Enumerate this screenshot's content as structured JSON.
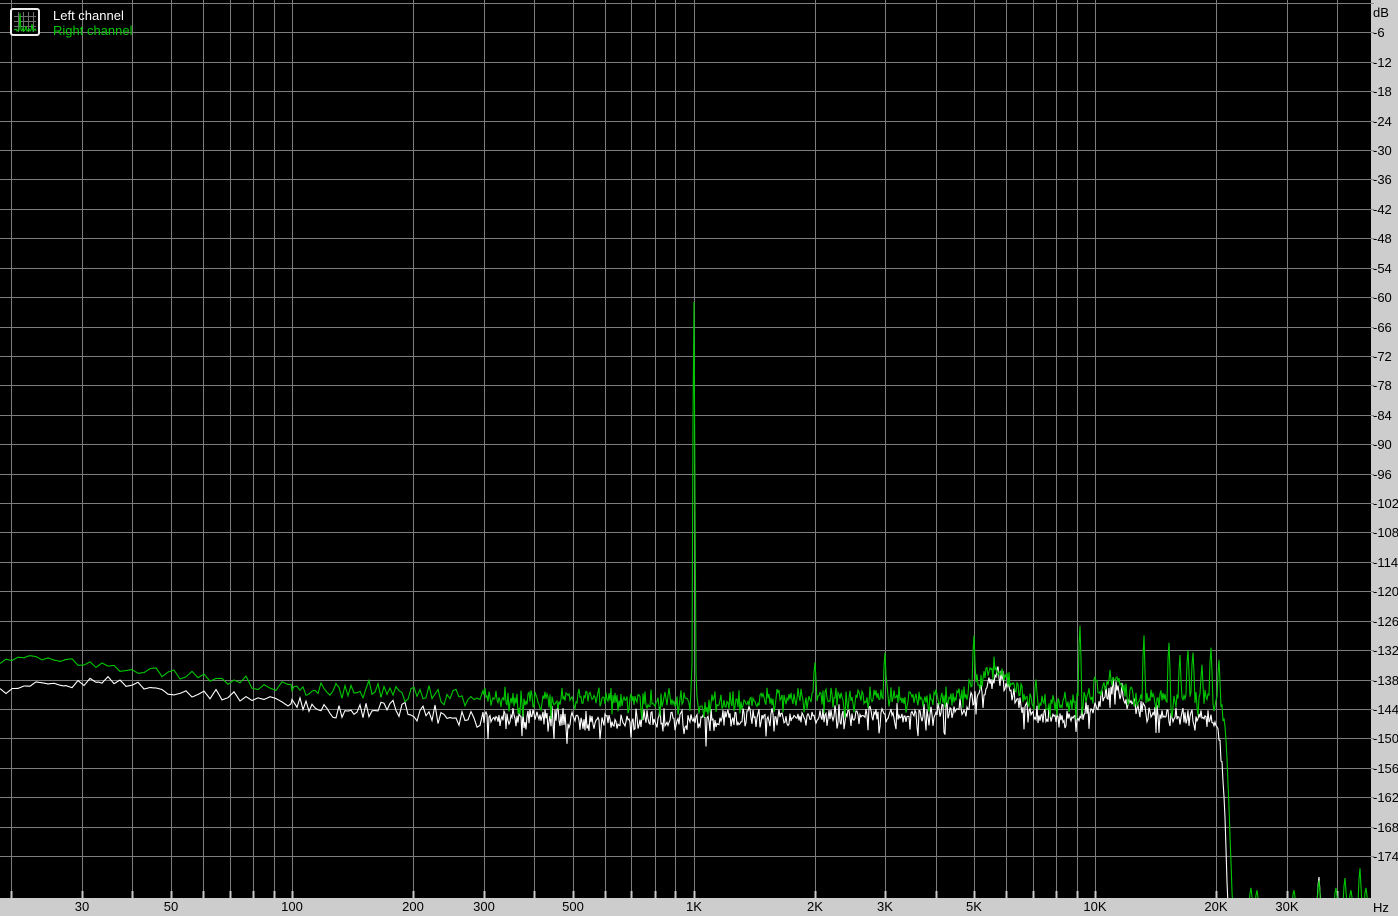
{
  "legend": {
    "icon": "spectrum-thumbnail-icon",
    "items": [
      {
        "label": "Left channel",
        "color": "#ffffff"
      },
      {
        "label": "Right channel",
        "color": "#00c800"
      }
    ]
  },
  "colors": {
    "background": "#000000",
    "grid": "#7d7d7d",
    "axis_bar": "#cdcdcd",
    "axis_text": "#000000",
    "bottom_tick": "#c9c9c9",
    "left_channel": "#ffffff",
    "right_channel": "#00c800"
  },
  "y_axis": {
    "unit_label": "dB",
    "step_db": 6,
    "tick_labels": [
      "dB",
      "-6",
      "-12",
      "-18",
      "-24",
      "-30",
      "-36",
      "-42",
      "-48",
      "-54",
      "-60",
      "-66",
      "-72",
      "-78",
      "-84",
      "-90",
      "-96",
      "-102",
      "-108",
      "-114",
      "-120",
      "-126",
      "-132",
      "-138",
      "-144",
      "-150",
      "-156",
      "-162",
      "-168",
      "-174"
    ]
  },
  "x_axis": {
    "unit_label": "Hz",
    "labeled_ticks": [
      {
        "label": "30",
        "freq": 30
      },
      {
        "label": "50",
        "freq": 50
      },
      {
        "label": "100",
        "freq": 100
      },
      {
        "label": "200",
        "freq": 200
      },
      {
        "label": "300",
        "freq": 300
      },
      {
        "label": "500",
        "freq": 500
      },
      {
        "label": "1K",
        "freq": 1000
      },
      {
        "label": "2K",
        "freq": 2000
      },
      {
        "label": "3K",
        "freq": 3000
      },
      {
        "label": "5K",
        "freq": 5000
      },
      {
        "label": "10K",
        "freq": 10000
      },
      {
        "label": "20K",
        "freq": 20000
      },
      {
        "label": "30K",
        "freq": 30000
      }
    ],
    "gridline_freqs": [
      20,
      30,
      40,
      50,
      60,
      70,
      80,
      90,
      100,
      200,
      300,
      400,
      500,
      600,
      700,
      800,
      900,
      1000,
      2000,
      3000,
      4000,
      5000,
      6000,
      7000,
      8000,
      9000,
      10000,
      20000,
      30000,
      40000
    ]
  },
  "chart_data": {
    "type": "line",
    "x_scale": "log",
    "x_unit": "Hz",
    "y_unit": "dB",
    "x_range": [
      20,
      48000
    ],
    "y_range": [
      -180,
      0
    ],
    "y_gridline_step_db": 6,
    "grid": true,
    "legend_position": "top-left",
    "description": "FFT noise spectrum, two channels; 1 kHz test tone present in right channel only; both channels cut off sharply above 20-21 kHz.",
    "series": [
      {
        "name": "Left channel",
        "color": "#ffffff",
        "envelope_db_by_freq": [
          [
            20,
            -140.3
          ],
          [
            23,
            -139.2
          ],
          [
            27,
            -139.6
          ],
          [
            33,
            -137.9
          ],
          [
            38,
            -138.6
          ],
          [
            45,
            -139.8
          ],
          [
            55,
            -140.6
          ],
          [
            70,
            -141.3
          ],
          [
            90,
            -142.2
          ],
          [
            110,
            -143.2
          ],
          [
            130,
            -144.6
          ],
          [
            160,
            -143.9
          ],
          [
            200,
            -144.4
          ],
          [
            260,
            -145.3
          ],
          [
            330,
            -145.9
          ],
          [
            420,
            -145.4
          ],
          [
            500,
            -145.8
          ],
          [
            650,
            -146.2
          ],
          [
            800,
            -145.9
          ],
          [
            1000,
            -146.4
          ],
          [
            1300,
            -146.0
          ],
          [
            1700,
            -145.7
          ],
          [
            2200,
            -145.2
          ],
          [
            2800,
            -145.0
          ],
          [
            3500,
            -145.3
          ],
          [
            4200,
            -145.0
          ],
          [
            4800,
            -143.6
          ],
          [
            5300,
            -139.8
          ],
          [
            5600,
            -136.6
          ],
          [
            5900,
            -138.4
          ],
          [
            6400,
            -142.4
          ],
          [
            7000,
            -145.2
          ],
          [
            8000,
            -146.0
          ],
          [
            9000,
            -145.4
          ],
          [
            9800,
            -143.8
          ],
          [
            10600,
            -140.4
          ],
          [
            11200,
            -139.4
          ],
          [
            12000,
            -142.3
          ],
          [
            13000,
            -144.6
          ],
          [
            14500,
            -145.5
          ],
          [
            16000,
            -145.2
          ],
          [
            17500,
            -145.0
          ],
          [
            19000,
            -145.8
          ],
          [
            19800,
            -146.4
          ],
          [
            20300,
            -149.5
          ],
          [
            20700,
            -156
          ],
          [
            21000,
            -165
          ],
          [
            21200,
            -176
          ],
          [
            21350,
            -184
          ],
          [
            48000,
            -184
          ]
        ],
        "spikes_db_by_freq": [
          [
            36100,
            -178.3
          ]
        ]
      },
      {
        "name": "Right channel",
        "color": "#00c800",
        "envelope_db_by_freq": [
          [
            20,
            -134.2
          ],
          [
            22,
            -133.6
          ],
          [
            26,
            -133.8
          ],
          [
            30,
            -134.6
          ],
          [
            36,
            -135.4
          ],
          [
            43,
            -136.2
          ],
          [
            52,
            -136.9
          ],
          [
            62,
            -137.6
          ],
          [
            75,
            -138.4
          ],
          [
            90,
            -139.2
          ],
          [
            110,
            -139.9
          ],
          [
            130,
            -140.4
          ],
          [
            160,
            -139.9
          ],
          [
            200,
            -140.7
          ],
          [
            250,
            -141.2
          ],
          [
            320,
            -141.6
          ],
          [
            400,
            -141.9
          ],
          [
            500,
            -141.6
          ],
          [
            650,
            -142.2
          ],
          [
            800,
            -142.0
          ],
          [
            1000,
            -142.4
          ],
          [
            1300,
            -142.3
          ],
          [
            1700,
            -142.0
          ],
          [
            2200,
            -141.6
          ],
          [
            2800,
            -141.3
          ],
          [
            3500,
            -141.8
          ],
          [
            4200,
            -141.5
          ],
          [
            4800,
            -140.2
          ],
          [
            5300,
            -137.2
          ],
          [
            5600,
            -134.9
          ],
          [
            5900,
            -136.6
          ],
          [
            6400,
            -139.9
          ],
          [
            7000,
            -142.2
          ],
          [
            8000,
            -142.8
          ],
          [
            9000,
            -142.2
          ],
          [
            9800,
            -141.0
          ],
          [
            10600,
            -138.3
          ],
          [
            11200,
            -137.8
          ],
          [
            12000,
            -140.3
          ],
          [
            13000,
            -141.9
          ],
          [
            14500,
            -142.4
          ],
          [
            16000,
            -142.0
          ],
          [
            17500,
            -141.8
          ],
          [
            19000,
            -142.2
          ],
          [
            20000,
            -142.4
          ],
          [
            20600,
            -143.5
          ],
          [
            21000,
            -147
          ],
          [
            21300,
            -155
          ],
          [
            21600,
            -168
          ],
          [
            21800,
            -178
          ],
          [
            21950,
            -184
          ],
          [
            48000,
            -184
          ]
        ],
        "spikes_db_by_freq": [
          [
            1000,
            -61
          ],
          [
            2000,
            -134.5
          ],
          [
            3000,
            -132.5
          ],
          [
            5000,
            -129
          ],
          [
            7100,
            -138
          ],
          [
            9170,
            -127
          ],
          [
            10000,
            -137.5
          ],
          [
            13200,
            -129
          ],
          [
            15250,
            -130.5
          ],
          [
            16200,
            -133
          ],
          [
            17000,
            -132
          ],
          [
            17500,
            -132.5
          ],
          [
            18400,
            -135
          ],
          [
            19400,
            -131.5
          ],
          [
            20300,
            -134
          ],
          [
            24400,
            -180.5
          ],
          [
            25300,
            -181
          ],
          [
            31300,
            -181
          ],
          [
            36100,
            -179
          ],
          [
            39800,
            -180.5
          ],
          [
            41700,
            -178.5
          ],
          [
            43400,
            -181
          ],
          [
            45700,
            -176.5
          ],
          [
            47300,
            -180.5
          ]
        ]
      }
    ],
    "noise_texture": {
      "amplitude_db_by_freq": [
        [
          20,
          0.7
        ],
        [
          60,
          1.0
        ],
        [
          120,
          1.6
        ],
        [
          250,
          2.2
        ],
        [
          18000,
          2.2
        ],
        [
          20300,
          1.6
        ],
        [
          21000,
          0.6
        ],
        [
          48000,
          0.35
        ]
      ]
    }
  }
}
